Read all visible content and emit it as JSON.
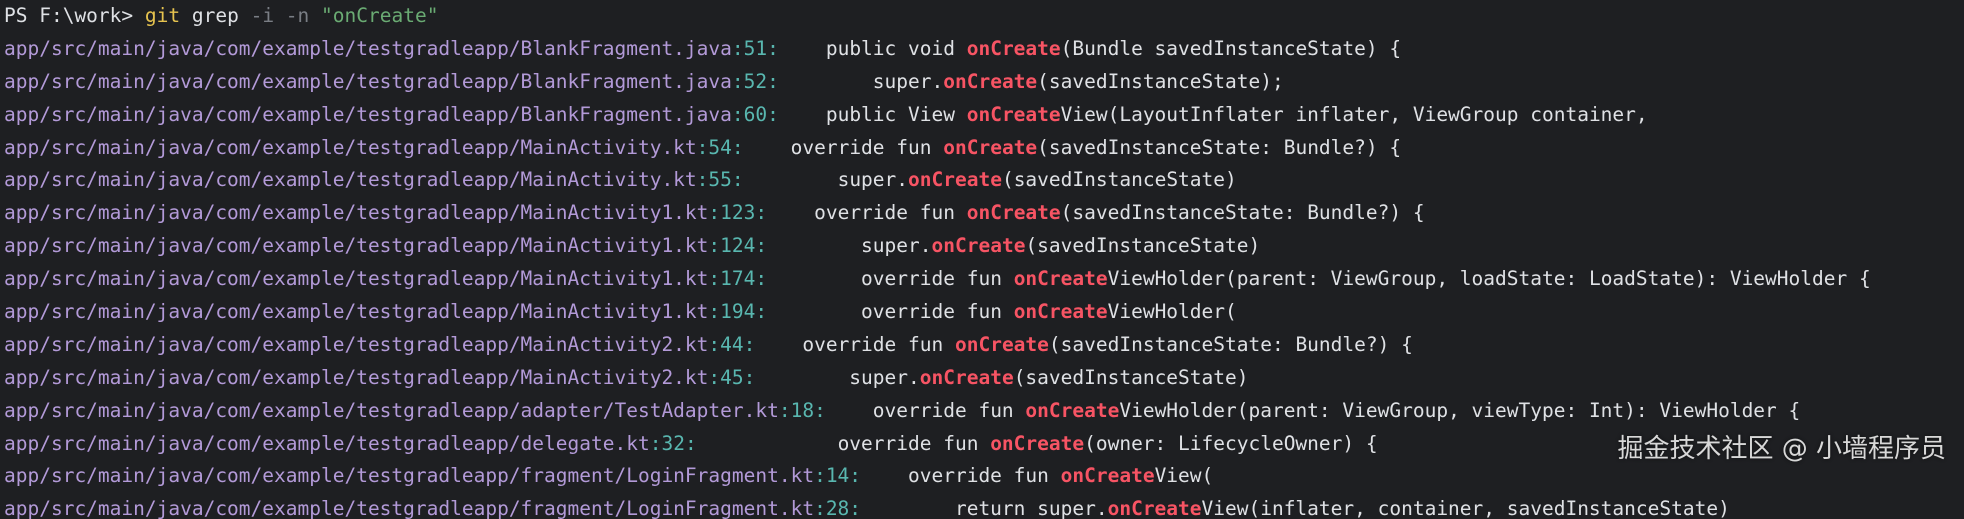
{
  "prompt": {
    "text": "PS F:\\work> ",
    "command": "git",
    "subcommand": " grep ",
    "flags": "-i -n ",
    "pattern": "\"onCreate\""
  },
  "results": [
    {
      "path": "app/src/main/java/com/example/testgradleapp/BlankFragment.java",
      "line": "51",
      "before": "    public void ",
      "match": "onCreate",
      "after": "(Bundle savedInstanceState) {"
    },
    {
      "path": "app/src/main/java/com/example/testgradleapp/BlankFragment.java",
      "line": "52",
      "before": "        super.",
      "match": "onCreate",
      "after": "(savedInstanceState);"
    },
    {
      "path": "app/src/main/java/com/example/testgradleapp/BlankFragment.java",
      "line": "60",
      "before": "    public View ",
      "match": "onCreate",
      "after": "View(LayoutInflater inflater, ViewGroup container,"
    },
    {
      "path": "app/src/main/java/com/example/testgradleapp/MainActivity.kt",
      "line": "54",
      "before": "    override fun ",
      "match": "onCreate",
      "after": "(savedInstanceState: Bundle?) {"
    },
    {
      "path": "app/src/main/java/com/example/testgradleapp/MainActivity.kt",
      "line": "55",
      "before": "        super.",
      "match": "onCreate",
      "after": "(savedInstanceState)"
    },
    {
      "path": "app/src/main/java/com/example/testgradleapp/MainActivity1.kt",
      "line": "123",
      "before": "    override fun ",
      "match": "onCreate",
      "after": "(savedInstanceState: Bundle?) {"
    },
    {
      "path": "app/src/main/java/com/example/testgradleapp/MainActivity1.kt",
      "line": "124",
      "before": "        super.",
      "match": "onCreate",
      "after": "(savedInstanceState)"
    },
    {
      "path": "app/src/main/java/com/example/testgradleapp/MainActivity1.kt",
      "line": "174",
      "before": "        override fun ",
      "match": "onCreate",
      "after": "ViewHolder(parent: ViewGroup, loadState: LoadState): ViewHolder {"
    },
    {
      "path": "app/src/main/java/com/example/testgradleapp/MainActivity1.kt",
      "line": "194",
      "before": "        override fun ",
      "match": "onCreate",
      "after": "ViewHolder("
    },
    {
      "path": "app/src/main/java/com/example/testgradleapp/MainActivity2.kt",
      "line": "44",
      "before": "    override fun ",
      "match": "onCreate",
      "after": "(savedInstanceState: Bundle?) {"
    },
    {
      "path": "app/src/main/java/com/example/testgradleapp/MainActivity2.kt",
      "line": "45",
      "before": "        super.",
      "match": "onCreate",
      "after": "(savedInstanceState)"
    },
    {
      "path": "app/src/main/java/com/example/testgradleapp/adapter/TestAdapter.kt",
      "line": "18",
      "before": "    override fun ",
      "match": "onCreate",
      "after": "ViewHolder(parent: ViewGroup, viewType: Int): ViewHolder {"
    },
    {
      "path": "app/src/main/java/com/example/testgradleapp/delegate.kt",
      "line": "32",
      "before": "            override fun ",
      "match": "onCreate",
      "after": "(owner: LifecycleOwner) {"
    },
    {
      "path": "app/src/main/java/com/example/testgradleapp/fragment/LoginFragment.kt",
      "line": "14",
      "before": "    override fun ",
      "match": "onCreate",
      "after": "View("
    },
    {
      "path": "app/src/main/java/com/example/testgradleapp/fragment/LoginFragment.kt",
      "line": "28",
      "before": "        return super.",
      "match": "onCreate",
      "after": "View(inflater, container, savedInstanceState)"
    }
  ],
  "watermark": "掘金技术社区 @ 小墙程序员",
  "colors": {
    "background": "#1e1f22",
    "path": "#b39ad8",
    "line_number": "#59b7b0",
    "match": "#f75464",
    "command": "#e6c34f",
    "string": "#6aab73"
  }
}
